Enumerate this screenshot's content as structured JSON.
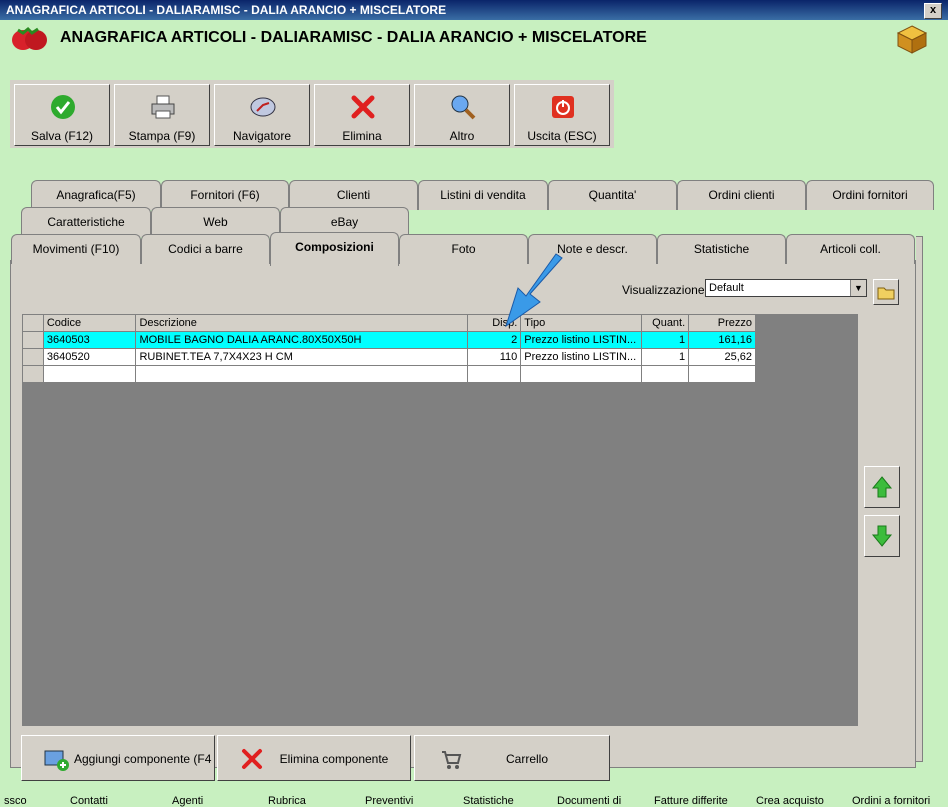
{
  "window": {
    "title": "ANAGRAFICA ARTICOLI - DALIARAMISC - DALIA ARANCIO + MISCELATORE",
    "close": "x"
  },
  "header": {
    "title": "ANAGRAFICA ARTICOLI - DALIARAMISC - DALIA ARANCIO + MISCELATORE"
  },
  "toolbar": {
    "salva": "Salva (F12)",
    "stampa": "Stampa (F9)",
    "navigatore": "Navigatore",
    "elimina": "Elimina",
    "altro": "Altro",
    "uscita": "Uscita (ESC)"
  },
  "tabs": {
    "row1": [
      "Anagrafica(F5)",
      "Fornitori (F6)",
      "Clienti",
      "Listini di vendita",
      "Quantita'",
      "Ordini clienti",
      "Ordini fornitori"
    ],
    "row2": [
      "Caratteristiche",
      "Web",
      "eBay"
    ],
    "row3": [
      "Movimenti (F10)",
      "Codici a barre",
      "Composizioni",
      "Foto",
      "Note e descr.",
      "Statistiche",
      "Articoli coll."
    ]
  },
  "visualizzazione": {
    "label": "Visualizzazione :",
    "value": "Default"
  },
  "grid": {
    "headers": [
      "Codice",
      "Descrizione",
      "Disp.",
      "Tipo",
      "Quant.",
      "Prezzo"
    ],
    "rows": [
      [
        "3640503",
        "MOBILE BAGNO DALIA ARANC.80X50X50H",
        "2",
        "Prezzo listino LISTIN...",
        "1",
        "161,16"
      ],
      [
        "3640520",
        "RUBINET.TEA 7,7X4X23 H CM",
        "110",
        "Prezzo listino LISTIN...",
        "1",
        "25,62"
      ]
    ]
  },
  "bottom_buttons": {
    "aggiungi": "Aggiungi componente (F4",
    "elimina": "Elimina componente",
    "carrello": "Carrello"
  },
  "footer_tabs": [
    "ssco",
    "Contatti",
    "Agenti",
    "Rubrica",
    "Preventivi",
    "Statistiche",
    "Documenti di",
    "Fatture differite",
    "Crea acquisto",
    "Ordini a fornitori"
  ]
}
